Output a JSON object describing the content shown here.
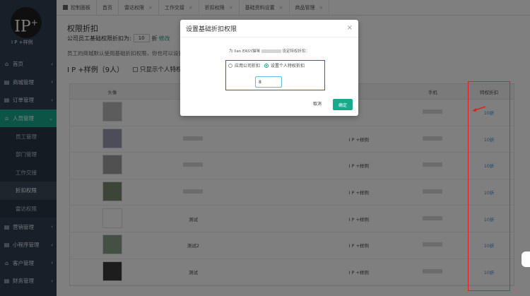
{
  "brand": {
    "logo_text": "IP",
    "logo_plus": "+",
    "sub": "I P +样例"
  },
  "sidebar": {
    "items": [
      {
        "label": "首页",
        "icon": "home-icon",
        "glyph": "⌂",
        "kind": "top"
      },
      {
        "label": "商城管理",
        "icon": "store-icon",
        "glyph": "▤",
        "kind": "top"
      },
      {
        "label": "订单管理",
        "icon": "order-icon",
        "glyph": "▤",
        "kind": "top"
      },
      {
        "label": "人员管理",
        "icon": "people-icon",
        "glyph": "⌂",
        "kind": "active"
      },
      {
        "label": "员工管理",
        "kind": "sub"
      },
      {
        "label": "部门管理",
        "kind": "sub"
      },
      {
        "label": "工作交接",
        "kind": "sub"
      },
      {
        "label": "折扣权限",
        "kind": "sub-current"
      },
      {
        "label": "雷达权限",
        "kind": "sub"
      },
      {
        "label": "营销管理",
        "icon": "marketing-icon",
        "glyph": "▤",
        "kind": "top"
      },
      {
        "label": "小程序管理",
        "icon": "miniapp-icon",
        "glyph": "▤",
        "kind": "top"
      },
      {
        "label": "客户管理",
        "icon": "customer-icon",
        "glyph": "⌂",
        "kind": "top"
      },
      {
        "label": "财务管理",
        "icon": "finance-icon",
        "glyph": "▤",
        "kind": "top"
      }
    ]
  },
  "tabs": [
    {
      "label": "控制面板",
      "home": true
    },
    {
      "label": "首页"
    },
    {
      "label": "雷达权限"
    },
    {
      "label": "工作交接"
    },
    {
      "label": "折扣权限"
    },
    {
      "label": "基础资料设置"
    },
    {
      "label": "商品管理"
    }
  ],
  "page": {
    "title": "权限折扣",
    "discount_label": "公司员工基础权限折扣为:",
    "discount_value": "10",
    "discount_unit": "折",
    "edit_label": "修改",
    "hint": "员工的商城默认使用基础折扣权限，你也可以设置...",
    "group_name": "I P +样例（9人）",
    "only_check_label": "只显示个人特权折扣"
  },
  "table": {
    "headers": [
      "头像",
      "",
      "",
      "",
      "手机",
      "特权折扣"
    ],
    "rows": [
      {
        "name": "",
        "dept": "",
        "discount": "10折",
        "avatar_color": "#b8b8b8"
      },
      {
        "name": "",
        "dept": "I P +样例",
        "discount": "10折",
        "avatar_color": "#9a9ab5"
      },
      {
        "name": "",
        "dept": "I P +样例",
        "discount": "10折",
        "avatar_color": "#a0a0a0"
      },
      {
        "name": "",
        "dept": "I P +样例",
        "discount": "10折",
        "avatar_color": "#7a8a70"
      },
      {
        "name": "测试",
        "dept": "I P +样例",
        "discount": "10折",
        "avatar_color": "#ffffff"
      },
      {
        "name": "测试2",
        "dept": "I P +样例",
        "discount": "10折",
        "avatar_color": "#8aa08a"
      },
      {
        "name": "测试",
        "dept": "I P +样例",
        "discount": "10折",
        "avatar_color": "#3a3a3a"
      }
    ]
  },
  "modal": {
    "title": "设置基础折扣权限",
    "close": "×",
    "desc_prefix": "为 Ilan EASY猫咪",
    "desc_suffix": "设定特权折扣：",
    "option_company": "应用公司折扣",
    "option_personal": "设置个人特权折扣",
    "selected": "personal",
    "input_value": "8",
    "cancel_label": "取消",
    "confirm_label": "确定"
  },
  "colors": {
    "sidebar": "#2f4050",
    "accent": "#19aa8d",
    "highlight": "#e02020",
    "link": "#3a8fd0"
  }
}
